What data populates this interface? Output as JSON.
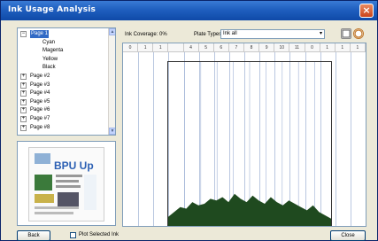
{
  "window": {
    "title": "Ink Usage Analysis",
    "close_glyph": "×"
  },
  "tree": {
    "items": [
      {
        "label": "Page 1",
        "expander": "−",
        "selected": true
      },
      {
        "label": "Cyan"
      },
      {
        "label": "Magenta"
      },
      {
        "label": "Yellow"
      },
      {
        "label": "Black"
      },
      {
        "label": "Page #2",
        "expander": "+"
      },
      {
        "label": "Page #3",
        "expander": "+"
      },
      {
        "label": "Page #4",
        "expander": "+"
      },
      {
        "label": "Page #5",
        "expander": "+"
      },
      {
        "label": "Page #6",
        "expander": "+"
      },
      {
        "label": "Page #7",
        "expander": "+"
      },
      {
        "label": "Page #8",
        "expander": "+"
      }
    ],
    "scroll_up": "▲",
    "scroll_down": "▼"
  },
  "thumbnail": {
    "headline": "BPU Up",
    "icon": "page-thumbnail-icon"
  },
  "controls": {
    "ink_coverage_label": "Ink Coverage: 0%",
    "plate_types_label": "Plate Types:",
    "plate_types_value": "Ink all",
    "dropdown_glyph": "▾",
    "icons": [
      "overlay-icon",
      "info-icon"
    ]
  },
  "ruler": {
    "marks": [
      "0",
      "1",
      "1",
      "",
      "4",
      "5",
      "6",
      "7",
      "8",
      "9",
      "10",
      "11",
      "0",
      "1",
      "1",
      "1"
    ]
  },
  "histogram": {
    "color": "#1f4a1f",
    "heights": [
      0.06,
      0.09,
      0.12,
      0.11,
      0.15,
      0.13,
      0.14,
      0.17,
      0.16,
      0.18,
      0.15,
      0.2,
      0.17,
      0.15,
      0.19,
      0.16,
      0.14,
      0.18,
      0.15,
      0.13,
      0.16,
      0.14,
      0.12,
      0.1,
      0.13,
      0.09,
      0.07,
      0.05
    ]
  },
  "footer": {
    "back_label": "Back",
    "checkbox_label": "Plot Selected Ink",
    "close_label": "Close"
  }
}
